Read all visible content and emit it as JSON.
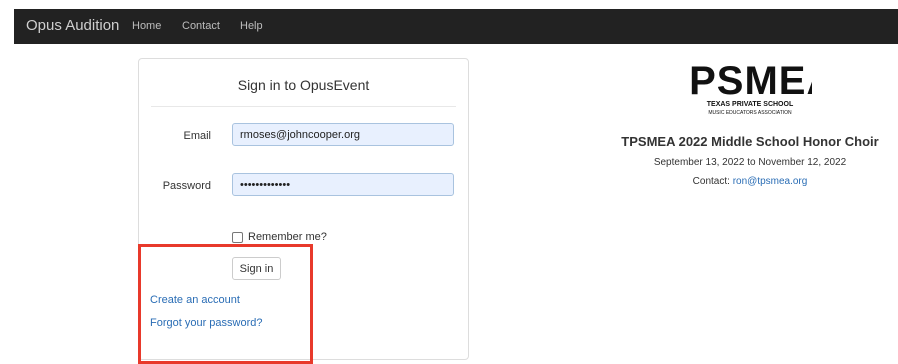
{
  "navbar": {
    "brand": "Opus Audition",
    "links": [
      "Home",
      "Contact",
      "Help"
    ]
  },
  "signin": {
    "title": "Sign in to OpusEvent",
    "email_label": "Email",
    "email_value": "rmoses@johncooper.org",
    "password_label": "Password",
    "password_value": "•••••••••••••",
    "remember_label": "Remember me?",
    "remember_checked": false,
    "signin_button": "Sign in",
    "create_account_link": "Create an account",
    "forgot_password_link": "Forgot your password?"
  },
  "event": {
    "logo_text": "TPSMEA",
    "logo_line1": "TEXAS PRIVATE SCHOOL",
    "logo_line2": "MUSIC EDUCATORS ASSOCIATION",
    "title": "TPSMEA 2022 Middle School Honor Choir",
    "dates": "September 13, 2022 to November 12, 2022",
    "contact_label": "Contact:",
    "contact_email": "ron@tpsmea.org"
  },
  "colors": {
    "navbar_bg": "#222222",
    "link": "#2a6db5",
    "autofill_bg": "#e8f0fe",
    "highlight": "#e8392b"
  }
}
